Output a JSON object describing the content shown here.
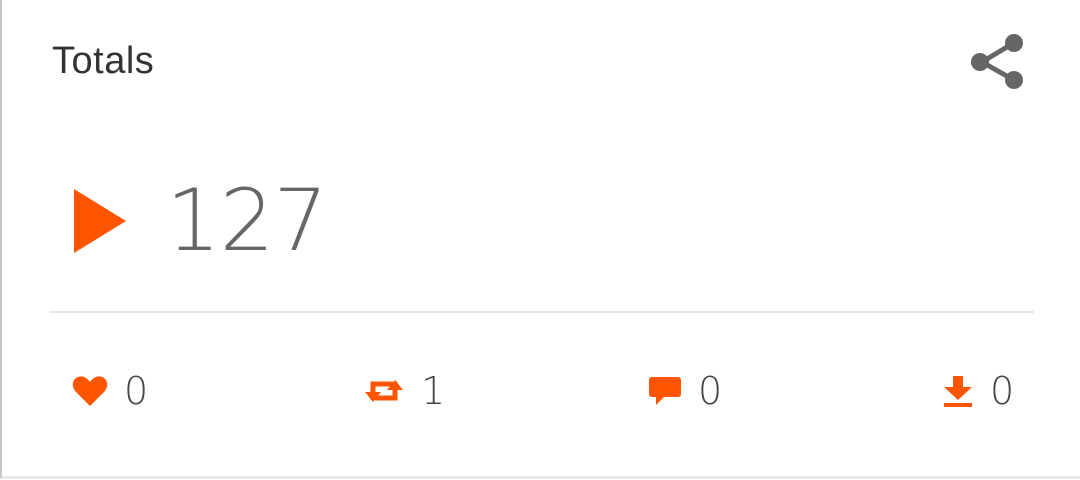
{
  "header": {
    "title": "Totals",
    "share_icon": "share-icon"
  },
  "plays": {
    "icon": "play-icon",
    "count": "127"
  },
  "stats": {
    "likes": {
      "icon": "heart-icon",
      "value": "0"
    },
    "reposts": {
      "icon": "repost-icon",
      "value": "1"
    },
    "comments": {
      "icon": "comment-icon",
      "value": "0"
    },
    "downloads": {
      "icon": "download-icon",
      "value": "0"
    }
  },
  "colors": {
    "accent": "#ff5500",
    "icon_gray": "#666666",
    "text": "#333333"
  }
}
